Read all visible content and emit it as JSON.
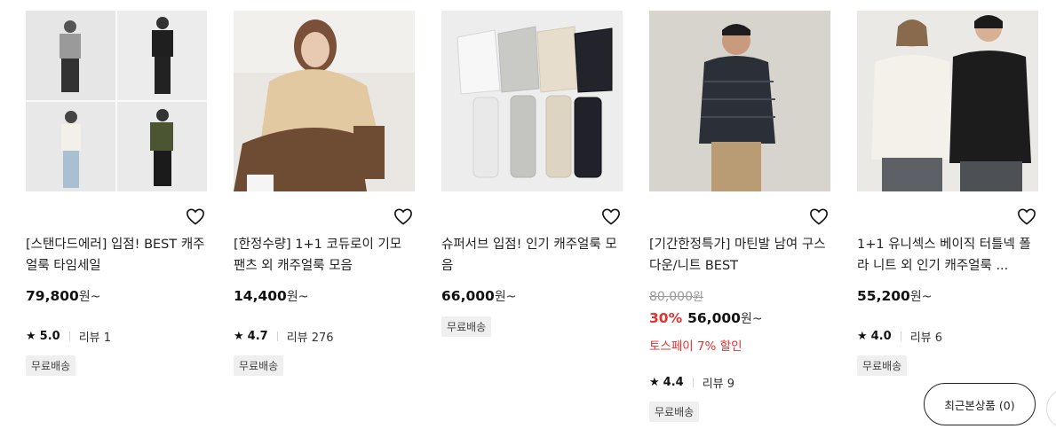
{
  "products": [
    {
      "title": "[스탠다드에러] 입점! BEST 캐주얼룩 타임세일",
      "price": "79,800",
      "won": "원~",
      "rating": "5.0",
      "reviews": "리뷰 1",
      "badge": "무료배송"
    },
    {
      "title": "[한정수량] 1+1 코듀로이 기모 팬츠 외 캐주얼룩 모음",
      "price": "14,400",
      "won": "원~",
      "rating": "4.7",
      "reviews": "리뷰 276",
      "badge": "무료배송"
    },
    {
      "title": "슈퍼서브 입점! 인기 캐주얼룩 모음",
      "price": "66,000",
      "won": "원~",
      "badge": "무료배송"
    },
    {
      "title": "[기간한정특가] 마틴발 남여 구스다운/니트 BEST",
      "original_price": "80,000",
      "original_won": "원",
      "discount": "30%",
      "price": "56,000",
      "won": "원~",
      "promo": "토스페이 7% 할인",
      "rating": "4.4",
      "reviews": "리뷰 9",
      "badge": "무료배송"
    },
    {
      "title": "1+1 유니섹스 베이직 터틀넥 폴라 니트 외 인기 캐주얼룩 ...",
      "price": "55,200",
      "won": "원~",
      "rating": "4.0",
      "reviews": "리뷰 6",
      "badge": "무료배송"
    }
  ],
  "recent_viewed": "최근본상품 (0)",
  "icons": {
    "wishlist": "heart-outline-icon",
    "star": "star-icon"
  }
}
